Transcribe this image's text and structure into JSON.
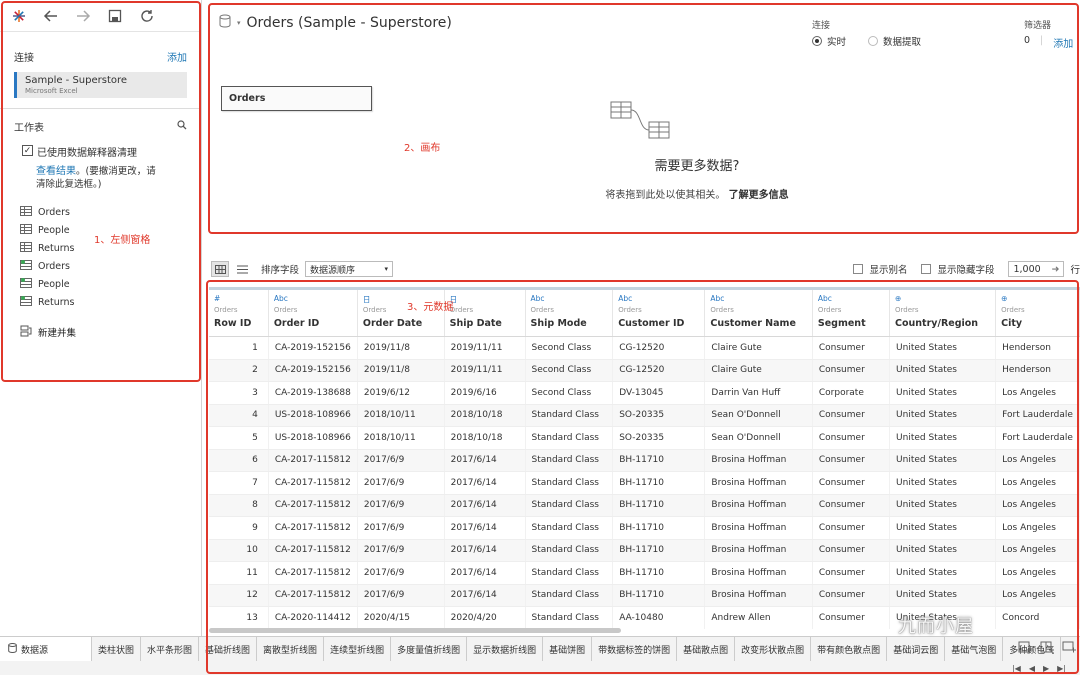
{
  "left": {
    "connections_title": "连接",
    "add_label": "添加",
    "connection_name": "Sample - Superstore",
    "connection_type": "Microsoft Excel",
    "worksheets_title": "工作表",
    "interpreter_label": "已使用数据解释器清理",
    "view_results_link": "查看结果",
    "interpreter_note": "。(要撤消更改，请清除此复选框。)",
    "sheets": [
      {
        "name": "Orders",
        "icon": "table-icon"
      },
      {
        "name": "People",
        "icon": "table-icon"
      },
      {
        "name": "Returns",
        "icon": "table-icon"
      },
      {
        "name": "Orders",
        "icon": "cleaned-table-icon"
      },
      {
        "name": "People",
        "icon": "cleaned-table-icon"
      },
      {
        "name": "Returns",
        "icon": "cleaned-table-icon"
      }
    ],
    "new_union": "新建并集"
  },
  "canvas": {
    "title": "Orders (Sample - Superstore)",
    "connection_label": "连接",
    "live_label": "实时",
    "extract_label": "数据提取",
    "filters_label": "筛选器",
    "filters_count": "0",
    "filters_add": "添加",
    "table_name": "Orders",
    "need_more_title": "需要更多数据?",
    "need_more_sub": "将表拖到此处以使其相关。",
    "learn_more": "了解更多信息"
  },
  "annotations": {
    "left": "1、左侧窗格",
    "canvas": "2、画布",
    "meta": "3、元数据"
  },
  "grid_toolbar": {
    "sort_label": "排序字段",
    "sort_value": "数据源顺序",
    "show_alias": "显示别名",
    "show_hidden": "显示隐藏字段",
    "rows_value": "1,000",
    "rows_label": "行"
  },
  "grid": {
    "columns": [
      {
        "type": "#",
        "src": "Orders",
        "name": "Row ID"
      },
      {
        "type": "Abc",
        "src": "Orders",
        "name": "Order ID"
      },
      {
        "type": "日",
        "src": "Orders",
        "name": "Order Date"
      },
      {
        "type": "日",
        "src": "Orders",
        "name": "Ship Date"
      },
      {
        "type": "Abc",
        "src": "Orders",
        "name": "Ship Mode"
      },
      {
        "type": "Abc",
        "src": "Orders",
        "name": "Customer ID"
      },
      {
        "type": "Abc",
        "src": "Orders",
        "name": "Customer Name"
      },
      {
        "type": "Abc",
        "src": "Orders",
        "name": "Segment"
      },
      {
        "type": "⊕",
        "src": "Orders",
        "name": "Country/Region"
      },
      {
        "type": "⊕",
        "src": "Orders",
        "name": "City"
      }
    ],
    "rows": [
      [
        "1",
        "CA-2019-152156",
        "2019/11/8",
        "2019/11/11",
        "Second Class",
        "CG-12520",
        "Claire Gute",
        "Consumer",
        "United States",
        "Henderson"
      ],
      [
        "2",
        "CA-2019-152156",
        "2019/11/8",
        "2019/11/11",
        "Second Class",
        "CG-12520",
        "Claire Gute",
        "Consumer",
        "United States",
        "Henderson"
      ],
      [
        "3",
        "CA-2019-138688",
        "2019/6/12",
        "2019/6/16",
        "Second Class",
        "DV-13045",
        "Darrin Van Huff",
        "Corporate",
        "United States",
        "Los Angeles"
      ],
      [
        "4",
        "US-2018-108966",
        "2018/10/11",
        "2018/10/18",
        "Standard Class",
        "SO-20335",
        "Sean O'Donnell",
        "Consumer",
        "United States",
        "Fort Lauderdale"
      ],
      [
        "5",
        "US-2018-108966",
        "2018/10/11",
        "2018/10/18",
        "Standard Class",
        "SO-20335",
        "Sean O'Donnell",
        "Consumer",
        "United States",
        "Fort Lauderdale"
      ],
      [
        "6",
        "CA-2017-115812",
        "2017/6/9",
        "2017/6/14",
        "Standard Class",
        "BH-11710",
        "Brosina Hoffman",
        "Consumer",
        "United States",
        "Los Angeles"
      ],
      [
        "7",
        "CA-2017-115812",
        "2017/6/9",
        "2017/6/14",
        "Standard Class",
        "BH-11710",
        "Brosina Hoffman",
        "Consumer",
        "United States",
        "Los Angeles"
      ],
      [
        "8",
        "CA-2017-115812",
        "2017/6/9",
        "2017/6/14",
        "Standard Class",
        "BH-11710",
        "Brosina Hoffman",
        "Consumer",
        "United States",
        "Los Angeles"
      ],
      [
        "9",
        "CA-2017-115812",
        "2017/6/9",
        "2017/6/14",
        "Standard Class",
        "BH-11710",
        "Brosina Hoffman",
        "Consumer",
        "United States",
        "Los Angeles"
      ],
      [
        "10",
        "CA-2017-115812",
        "2017/6/9",
        "2017/6/14",
        "Standard Class",
        "BH-11710",
        "Brosina Hoffman",
        "Consumer",
        "United States",
        "Los Angeles"
      ],
      [
        "11",
        "CA-2017-115812",
        "2017/6/9",
        "2017/6/14",
        "Standard Class",
        "BH-11710",
        "Brosina Hoffman",
        "Consumer",
        "United States",
        "Los Angeles"
      ],
      [
        "12",
        "CA-2017-115812",
        "2017/6/9",
        "2017/6/14",
        "Standard Class",
        "BH-11710",
        "Brosina Hoffman",
        "Consumer",
        "United States",
        "Los Angeles"
      ],
      [
        "13",
        "CA-2020-114412",
        "2020/4/15",
        "2020/4/20",
        "Standard Class",
        "AA-10480",
        "Andrew Allen",
        "Consumer",
        "United States",
        "Concord"
      ]
    ]
  },
  "tabs": {
    "data_source": "数据源",
    "sheets": [
      "类柱状图",
      "水平条形图",
      "基础折线图",
      "离散型折线图",
      "连续型折线图",
      "多度量值折线图",
      "显示数据折线图",
      "基础饼图",
      "带数据标签的饼图",
      "基础散点图",
      "改变形状散点图",
      "带有颜色散点图",
      "基础词云图",
      "基础气泡图",
      "多种颜色气"
    ]
  },
  "watermark": "九而小屋",
  "colors": {
    "annotation": "#e0382b",
    "accent": "#1f77b4"
  }
}
